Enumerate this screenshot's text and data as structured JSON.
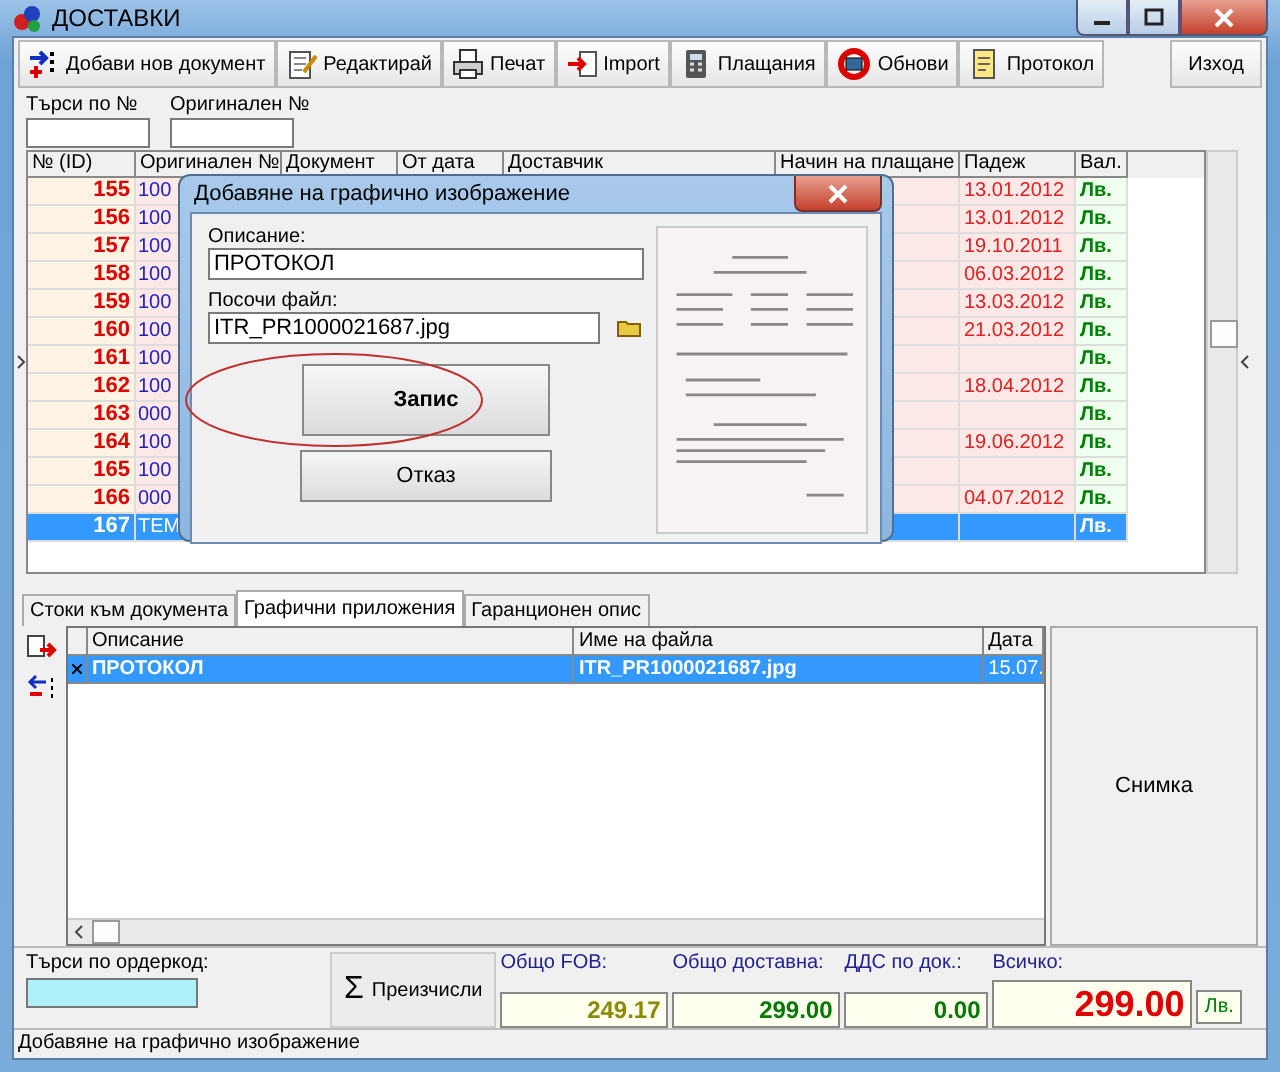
{
  "window": {
    "title": "ДОСТАВКИ"
  },
  "toolbar": [
    {
      "label": "Добави нов документ",
      "kind": "add"
    },
    {
      "label": "Редактирай",
      "kind": "edit"
    },
    {
      "label": "Печат",
      "kind": "print"
    },
    {
      "label": "Import",
      "kind": "import"
    },
    {
      "label": "Плащания",
      "kind": "payments"
    },
    {
      "label": "Обнови",
      "kind": "refresh"
    },
    {
      "label": "Протокол",
      "kind": "protocol"
    }
  ],
  "exit_button": "Изход",
  "search": [
    {
      "label": "Търси по №"
    },
    {
      "label": "Оригинален №"
    }
  ],
  "table": {
    "columns": [
      "№ (ID)",
      "Оригинален №",
      "Документ",
      "От дата",
      "Доставчик",
      "Начин на плащане",
      "Падеж",
      "Вал."
    ],
    "rows": [
      {
        "id": "155",
        "original": "100",
        "due": "13.01.2012",
        "currency": "Лв.",
        "selected": false
      },
      {
        "id": "156",
        "original": "100",
        "due": "13.01.2012",
        "currency": "Лв.",
        "selected": false
      },
      {
        "id": "157",
        "original": "100",
        "due": "19.10.2011",
        "currency": "Лв.",
        "selected": false
      },
      {
        "id": "158",
        "original": "100",
        "due": "06.03.2012",
        "currency": "Лв.",
        "selected": false
      },
      {
        "id": "159",
        "original": "100",
        "due": "13.03.2012",
        "currency": "Лв.",
        "selected": false
      },
      {
        "id": "160",
        "original": "100",
        "due": "21.03.2012",
        "currency": "Лв.",
        "selected": false
      },
      {
        "id": "161",
        "original": "100",
        "due": "",
        "currency": "Лв.",
        "selected": false
      },
      {
        "id": "162",
        "original": "100",
        "due": "18.04.2012",
        "currency": "Лв.",
        "selected": false
      },
      {
        "id": "163",
        "original": "000",
        "due": "",
        "currency": "Лв.",
        "selected": false
      },
      {
        "id": "164",
        "original": "100",
        "due": "19.06.2012",
        "currency": "Лв.",
        "selected": false
      },
      {
        "id": "165",
        "original": "100",
        "due": "",
        "currency": "Лв.",
        "selected": false
      },
      {
        "id": "166",
        "original": "000",
        "due": "04.07.2012",
        "currency": "Лв.",
        "selected": false
      },
      {
        "id": "167",
        "original": "TEM",
        "due": "",
        "currency": "Лв.",
        "selected": true
      }
    ]
  },
  "dialog": {
    "title": "Добавяне на графично изображение",
    "description_label": "Описание:",
    "description_value": "ПРОТОКОЛ",
    "file_label": "Посочи файл:",
    "file_value": "ITR_PR1000021687.jpg",
    "buttons": [
      {
        "label": "Запис",
        "kind": "save",
        "highlighted": true
      },
      {
        "label": "Отказ",
        "kind": "cancel",
        "highlighted": false
      }
    ]
  },
  "tabs": [
    {
      "label": "Стоки към документа",
      "selected": false
    },
    {
      "label": "Графични приложения",
      "selected": true
    },
    {
      "label": "Гаранционен опис",
      "selected": false
    }
  ],
  "attachments": {
    "columns": [
      "Описание",
      "Име на файла",
      "Дата"
    ],
    "rows": [
      {
        "description": "ПРОТОКОЛ",
        "file": "ITR_PR1000021687.jpg",
        "date": "15.07.",
        "selected": true
      }
    ]
  },
  "photo_button": "Снимка",
  "footer": {
    "order_search_label": "Търси по ордеркод:",
    "recalc_symbol": "Σ",
    "recalc_button": "Преизчисли",
    "totals": [
      {
        "label": "Общо FOB:",
        "value": "249.17",
        "color": "#8a8a00"
      },
      {
        "label": "Общо доставна:",
        "value": "299.00",
        "color": "#007a00"
      },
      {
        "label": "ДДС по док.:",
        "value": "0.00",
        "color": "#007a00"
      },
      {
        "label": "Всичко:",
        "value": "299.00",
        "color": "#e00000"
      }
    ],
    "currency": "Лв."
  },
  "status_bar": "Добавяне на графично изображение"
}
